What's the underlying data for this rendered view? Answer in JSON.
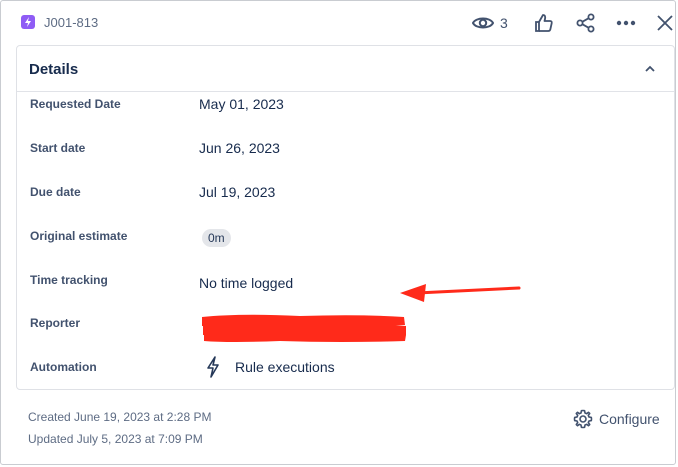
{
  "header": {
    "issue_key": "J001-813",
    "watch_count": "3",
    "icons": [
      "lightning-icon",
      "eye-icon",
      "thumbs-up-icon",
      "share-icon",
      "more-icon",
      "close-icon"
    ]
  },
  "details": {
    "title": "Details",
    "fields": [
      {
        "label": "Requested Date",
        "value": "May 01, 2023"
      },
      {
        "label": "Start date",
        "value": "Jun 26, 2023"
      },
      {
        "label": "Due date",
        "value": "Jul 19, 2023"
      },
      {
        "label": "Original estimate",
        "value": "0m"
      },
      {
        "label": "Time tracking",
        "value": "No time logged"
      },
      {
        "label": "Reporter",
        "value": ""
      },
      {
        "label": "Automation",
        "value": "Rule executions"
      }
    ]
  },
  "footer": {
    "created": "Created June 19, 2023 at 2:28 PM",
    "updated": "Updated July 5, 2023 at 7:09 PM",
    "configure_label": "Configure"
  },
  "colors": {
    "issue_type": "#8f5cf5",
    "annotation_red": "#ff2a1a",
    "text_primary": "#172b4d",
    "text_secondary": "#5e6c84"
  }
}
